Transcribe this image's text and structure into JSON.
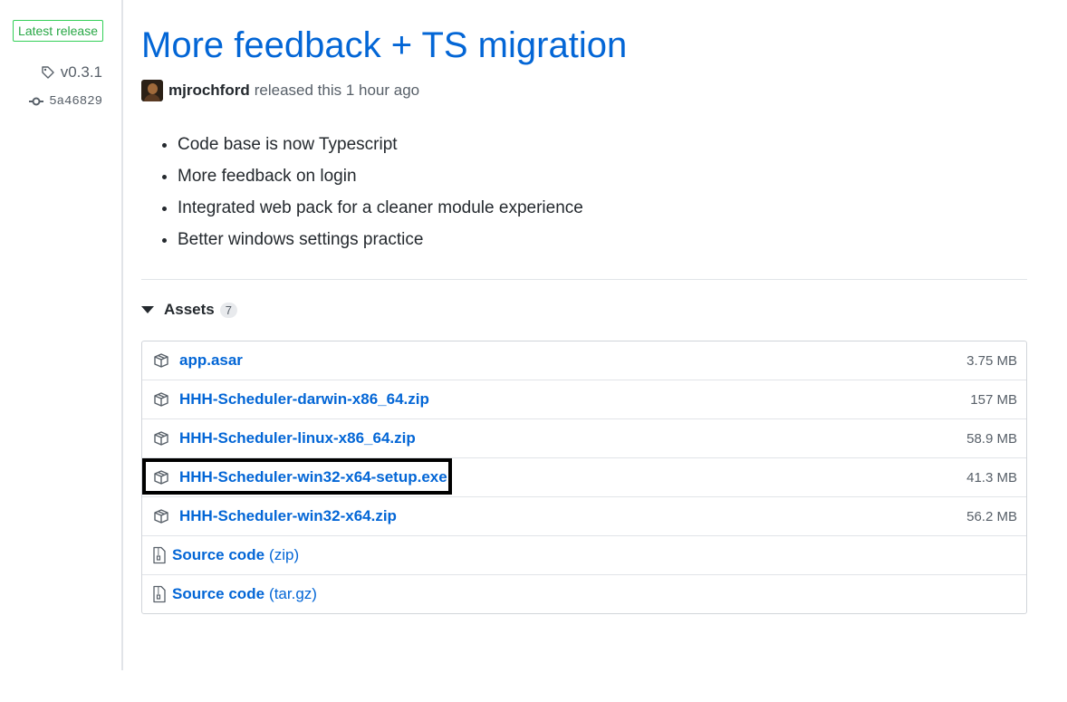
{
  "sidebar": {
    "latest_label": "Latest release",
    "tag": "v0.3.1",
    "commit": "5a46829"
  },
  "release": {
    "title": "More feedback + TS migration",
    "author": "mjrochford",
    "released_text": "released this 1 hour ago",
    "notes": [
      "Code base is now Typescript",
      "More feedback on login",
      "Integrated web pack for a cleaner module experience",
      "Better windows settings practice"
    ]
  },
  "assets": {
    "label": "Assets",
    "count": "7",
    "files": [
      {
        "name": "app.asar",
        "size": "3.75 MB"
      },
      {
        "name": "HHH-Scheduler-darwin-x86_64.zip",
        "size": "157 MB"
      },
      {
        "name": "HHH-Scheduler-linux-x86_64.zip",
        "size": "58.9 MB"
      },
      {
        "name": "HHH-Scheduler-win32-x64-setup.exe",
        "size": "41.3 MB"
      },
      {
        "name": "HHH-Scheduler-win32-x64.zip",
        "size": "56.2 MB"
      }
    ],
    "source": [
      {
        "label": "Source code",
        "format": "(zip)"
      },
      {
        "label": "Source code",
        "format": "(tar.gz)"
      }
    ]
  },
  "colors": {
    "link": "#0366d6",
    "latest_badge": "#28a745",
    "highlight_box": "#000000"
  },
  "icons": {
    "tag": "tag-icon",
    "commit": "commit-icon",
    "package": "package-icon",
    "zip": "file-zip-icon",
    "caret": "caret-down-icon"
  }
}
